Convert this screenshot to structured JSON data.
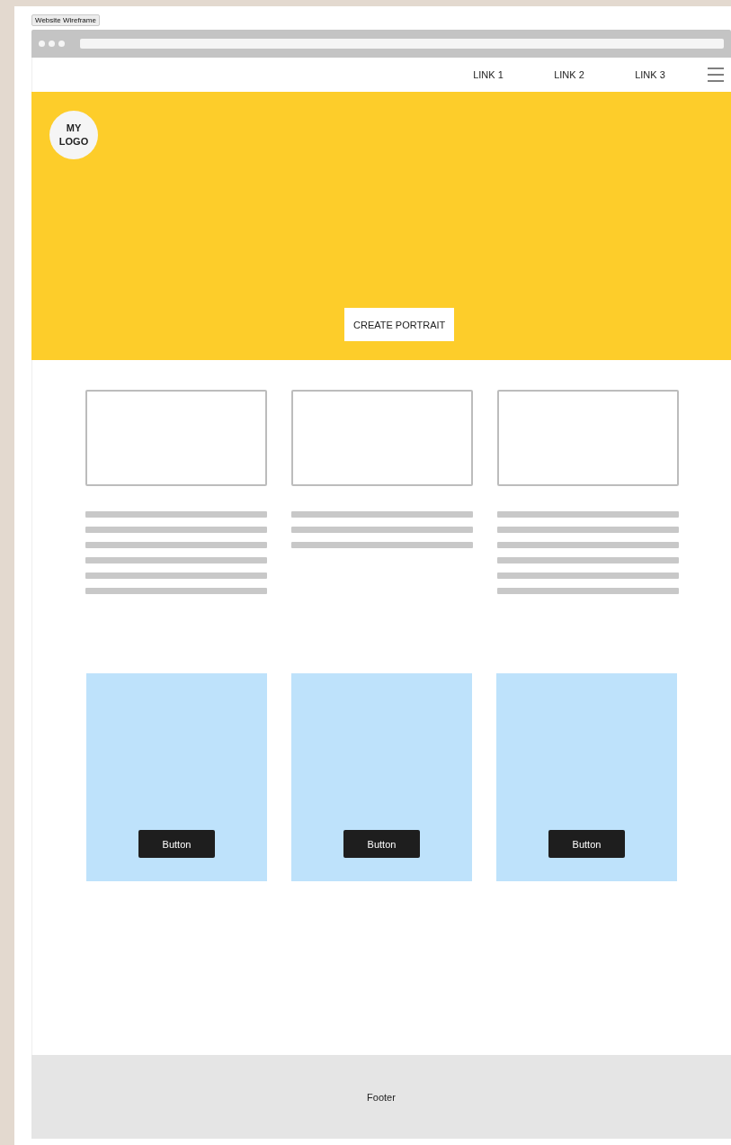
{
  "frame_label": "Website Wireframe",
  "nav": {
    "links": [
      "LINK 1",
      "LINK 2",
      "LINK 3"
    ]
  },
  "hero": {
    "logo": "MY\nLOGO",
    "button": "CREATE PORTRAIT"
  },
  "columns": [
    {
      "kind": "long"
    },
    {
      "kind": "short"
    },
    {
      "kind": "long"
    }
  ],
  "cards": [
    {
      "button": "Button"
    },
    {
      "button": "Button"
    },
    {
      "button": "Button"
    }
  ],
  "footer": "Footer"
}
